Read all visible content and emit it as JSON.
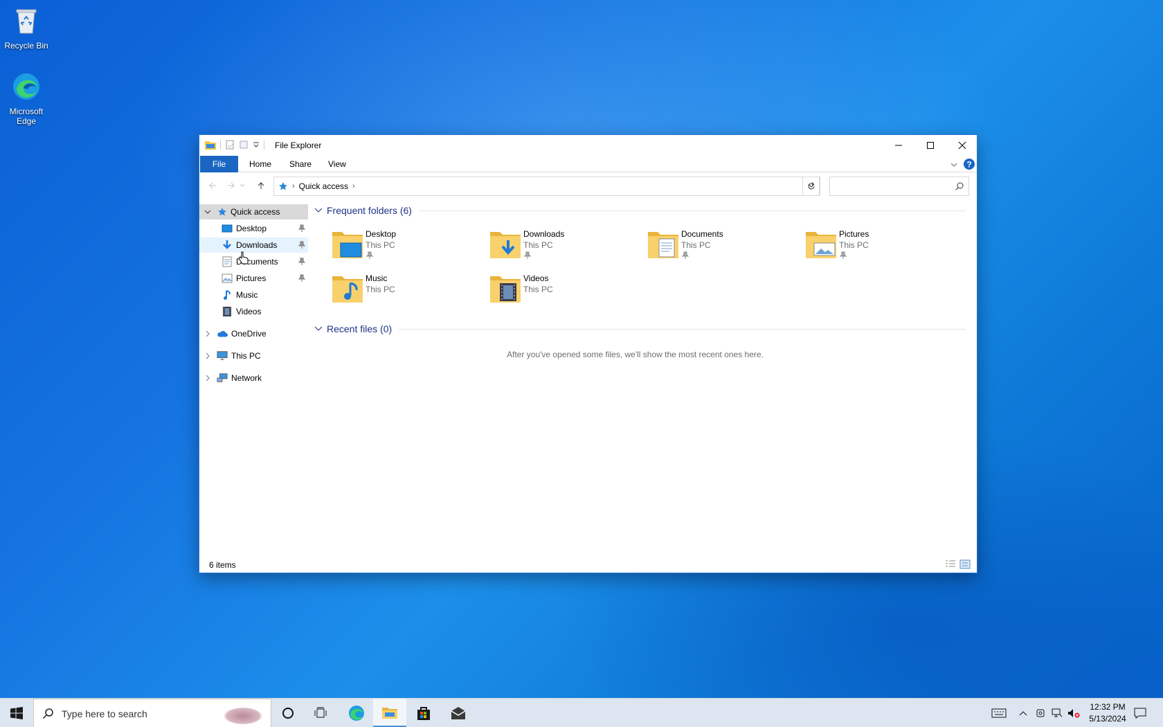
{
  "desktop": {
    "icons": [
      {
        "label": "Recycle Bin"
      },
      {
        "label": "Microsoft Edge"
      }
    ]
  },
  "window": {
    "title": "File Explorer",
    "ribbon_tabs": [
      "File",
      "Home",
      "Share",
      "View"
    ],
    "address": {
      "crumb": "Quick access"
    },
    "search": {
      "placeholder": ""
    },
    "status": "6 items"
  },
  "navpane": {
    "quick_access": "Quick access",
    "pinned": [
      {
        "label": "Desktop",
        "pinned": true
      },
      {
        "label": "Downloads",
        "pinned": true
      },
      {
        "label": "Documents",
        "pinned": true
      },
      {
        "label": "Pictures",
        "pinned": true
      },
      {
        "label": "Music",
        "pinned": false
      },
      {
        "label": "Videos",
        "pinned": false
      }
    ],
    "roots": [
      {
        "label": "OneDrive"
      },
      {
        "label": "This PC"
      },
      {
        "label": "Network"
      }
    ]
  },
  "content": {
    "frequent_header": "Frequent folders (6)",
    "folders": [
      {
        "name": "Desktop",
        "location": "This PC"
      },
      {
        "name": "Downloads",
        "location": "This PC"
      },
      {
        "name": "Documents",
        "location": "This PC"
      },
      {
        "name": "Pictures",
        "location": "This PC"
      },
      {
        "name": "Music",
        "location": "This PC"
      },
      {
        "name": "Videos",
        "location": "This PC"
      }
    ],
    "recent_header": "Recent files (0)",
    "recent_empty": "After you've opened some files, we'll show the most recent ones here."
  },
  "taskbar": {
    "search_placeholder": "Type here to search",
    "time": "12:32 PM",
    "date": "5/13/2024"
  },
  "colors": {
    "accent": "#1a66c2",
    "group_header": "#1e3287",
    "folder": "#f5c542"
  }
}
